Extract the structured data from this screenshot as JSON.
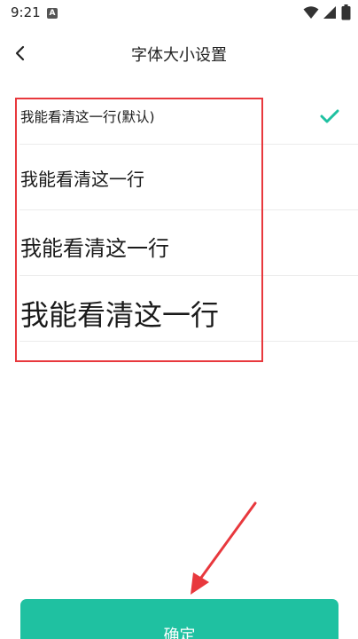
{
  "status_bar": {
    "time": "9:21",
    "app_icon_letter": "A",
    "icons": [
      "wifi-icon",
      "signal-icon",
      "battery-icon"
    ]
  },
  "header": {
    "back_icon": "chevron-left-icon",
    "title": "字体大小设置"
  },
  "font_options": [
    {
      "label": "我能看清这一行(默认)",
      "selected": true
    },
    {
      "label": "我能看清这一行",
      "selected": false
    },
    {
      "label": "我能看清这一行",
      "selected": false
    },
    {
      "label": "我能看清这一行",
      "selected": false
    }
  ],
  "confirm_button": {
    "label": "确定"
  },
  "colors": {
    "accent": "#1fc1a1",
    "check": "#1fc1a1",
    "annotation": "#e8383d",
    "divider": "#ececec"
  }
}
